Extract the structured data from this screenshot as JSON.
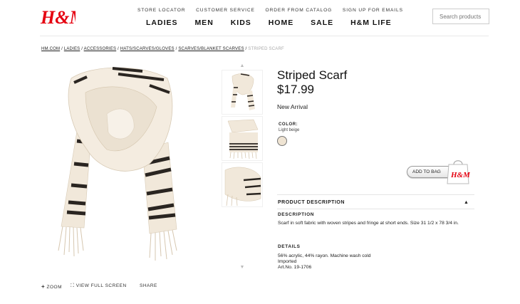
{
  "brand": {
    "logo_text": "H&M"
  },
  "top_links": [
    "STORE LOCATOR",
    "CUSTOMER SERVICE",
    "ORDER FROM CATALOG",
    "SIGN UP FOR EMAILS"
  ],
  "main_nav": [
    "LADIES",
    "MEN",
    "KIDS",
    "HOME",
    "SALE",
    "H&M LIFE"
  ],
  "search": {
    "placeholder": "Search products"
  },
  "breadcrumb": {
    "links": [
      "HM.COM",
      "LADIES",
      "ACCESSORIES",
      "HATS/SCARVES/GLOVES",
      "SCARVES/BLANKET SCARVES"
    ],
    "separator": " / ",
    "current": "STRIPED SCARF"
  },
  "product": {
    "title": "Striped Scarf",
    "price": "$17.99",
    "badge": "New Arrival",
    "color_label": "COLOR:",
    "color_value": "Light beige",
    "swatch_color": "#efe4d3",
    "add_to_bag": "ADD TO BAG"
  },
  "description": {
    "section_title": "PRODUCT DESCRIPTION",
    "heading": "DESCRIPTION",
    "text": "Scarf in soft fabric with woven stripes and fringe at short ends. Size 31 1/2 x 78 3/4 in.",
    "details_heading": "DETAILS",
    "details": [
      "56% acrylic, 44% rayon. Machine wash cold",
      "Imported",
      "Art.No. 19-1706"
    ]
  },
  "image_tools": {
    "zoom": "ZOOM",
    "fullscreen": "VIEW FULL SCREEN",
    "share": "SHARE"
  },
  "colors": {
    "brand_red": "#e50010",
    "scarf": "#f1e8da",
    "stripe": "#2a2521"
  }
}
